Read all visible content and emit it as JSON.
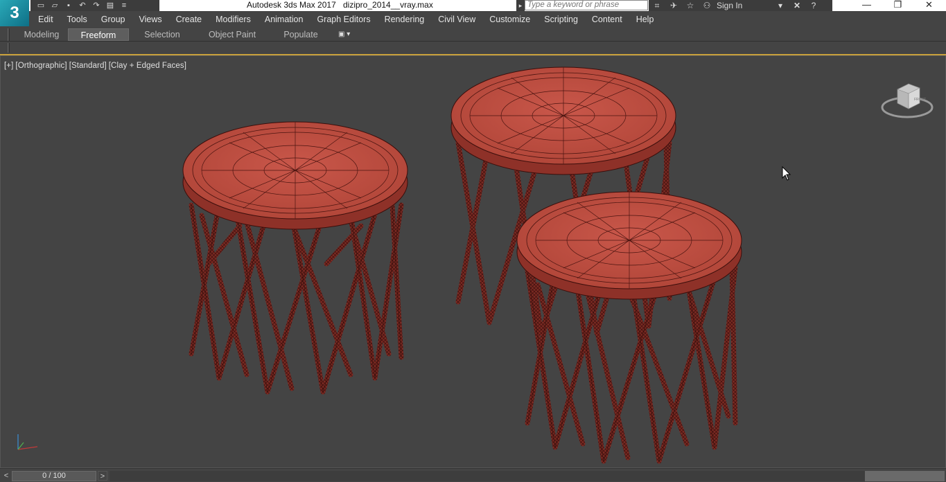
{
  "titlebar": {
    "app_logo": "3",
    "app_title": "Autodesk 3ds Max 2017",
    "file_name": "dizipro_2014__vray.max",
    "search_placeholder": "Type a keyword or phrase",
    "sign_in": "Sign In",
    "quick_access_icons": [
      "new-file-icon",
      "open-file-icon",
      "save-icon",
      "undo-icon",
      "redo-icon",
      "project-icon",
      "workspace-dropdown-icon"
    ],
    "toolbar_icons": [
      "binoculars-icon",
      "satellite-icon",
      "star-icon",
      "user-icon",
      "exchange-x-icon",
      "help-icon"
    ],
    "window_controls": [
      "minimize",
      "restore",
      "close"
    ]
  },
  "menubar": {
    "items": [
      "Edit",
      "Tools",
      "Group",
      "Views",
      "Create",
      "Modifiers",
      "Animation",
      "Graph Editors",
      "Rendering",
      "Civil View",
      "Customize",
      "Scripting",
      "Content",
      "Help"
    ]
  },
  "ribbon": {
    "tabs": [
      "Modeling",
      "Freeform",
      "Selection",
      "Object Paint",
      "Populate"
    ],
    "active_tab": "Freeform"
  },
  "viewport": {
    "label_plus": "[+]",
    "label_view": "[Orthographic]",
    "label_shading": "[Standard]",
    "label_style": "[Clay + Edged Faces]",
    "viewcube_face": "FRONT",
    "object_color": "#b54a3e",
    "background_color": "#444444"
  },
  "timeslider": {
    "frame_label": "0 / 100",
    "prev": "<",
    "next": ">"
  }
}
